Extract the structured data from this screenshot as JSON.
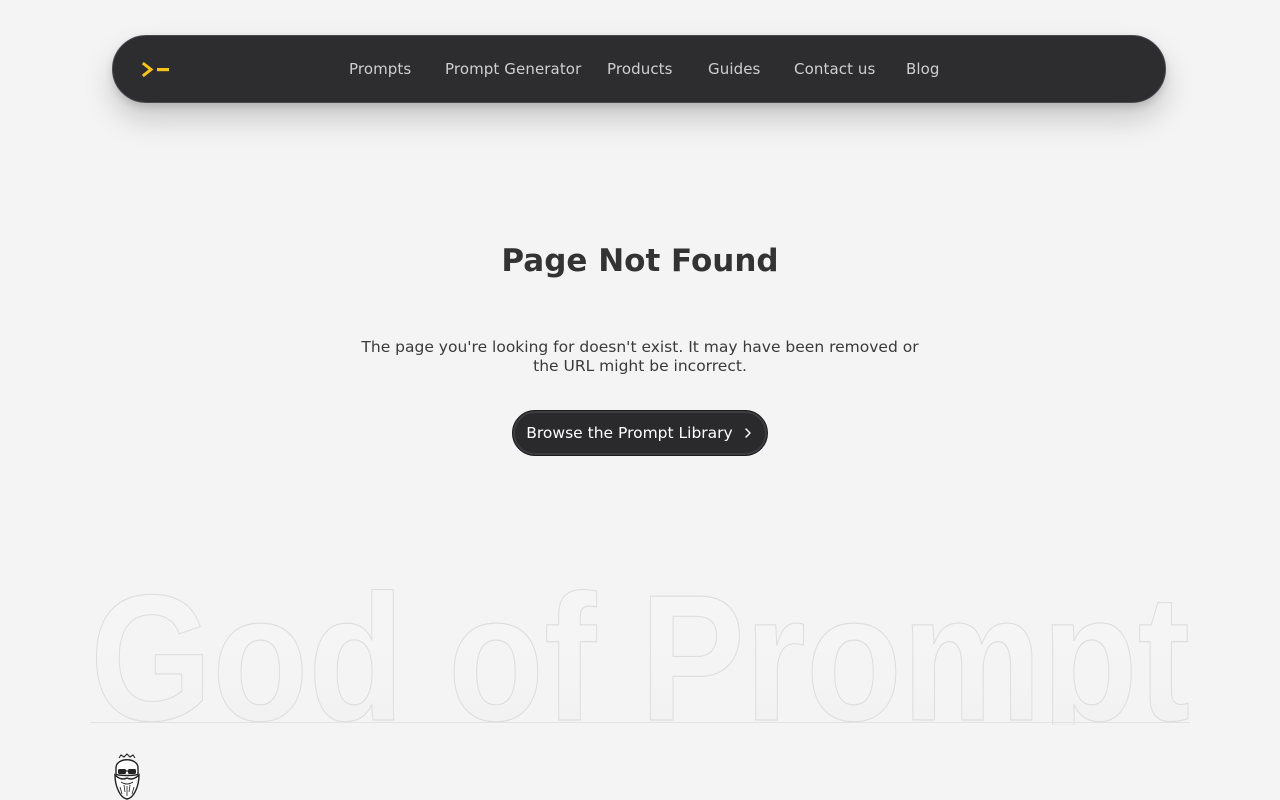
{
  "nav": {
    "links": [
      {
        "label": "Prompts"
      },
      {
        "label": "Prompt Generator"
      },
      {
        "label": "Products"
      },
      {
        "label": "Guides"
      },
      {
        "label": "Contact us"
      },
      {
        "label": "Blog"
      }
    ]
  },
  "main": {
    "title": "Page Not Found",
    "description": "The page you're looking for doesn't exist. It may have been removed or the URL might be incorrect.",
    "cta_label": "Browse the Prompt Library"
  },
  "footer": {
    "brand_word": "God of Prompt"
  },
  "colors": {
    "accent": "#f5c518",
    "nav_bg": "#2d2c2e",
    "page_bg": "#f4f4f4"
  },
  "icons": {
    "logo": "terminal-prompt-icon",
    "cta": "chevron-right-icon",
    "avatar": "bearded-face-avatar-icon"
  }
}
